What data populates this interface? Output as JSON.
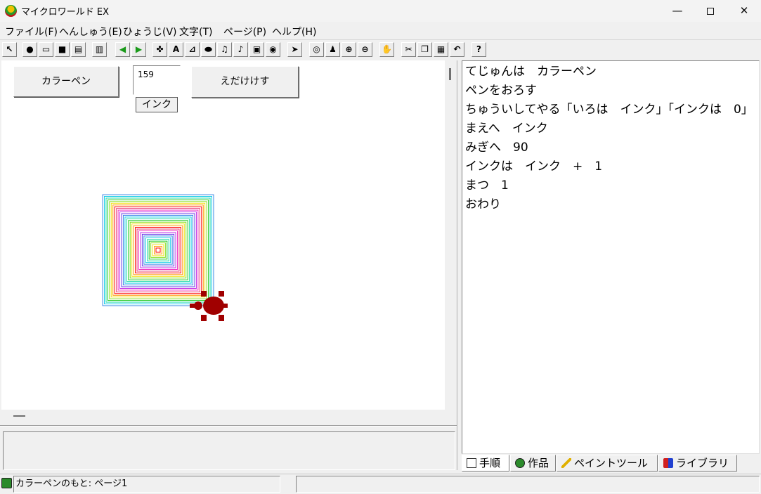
{
  "window": {
    "title": "マイクロワールド EX"
  },
  "menu": [
    "ファイル(F)",
    "へんしゅう(E)",
    "ひょうじ(V)",
    "文字(T)",
    "ページ(P)",
    "ヘルプ(H)"
  ],
  "toolbar": [
    {
      "icon": "pointer-arrow-icon"
    },
    {
      "icon": "globe-icon"
    },
    {
      "icon": "open-folder-icon"
    },
    {
      "icon": "save-icon"
    },
    {
      "icon": "print-icon"
    },
    {
      "icon": "pages-icon"
    },
    {
      "icon": "previous-page-icon"
    },
    {
      "icon": "next-page-icon"
    },
    {
      "icon": "new-turtle-icon"
    },
    {
      "icon": "text-box-icon"
    },
    {
      "icon": "slider-icon"
    },
    {
      "icon": "button-icon"
    },
    {
      "icon": "music-icon"
    },
    {
      "icon": "sound-icon"
    },
    {
      "icon": "video-icon"
    },
    {
      "icon": "shape-center-icon"
    },
    {
      "icon": "select-arrow-icon"
    },
    {
      "icon": "eye-icon"
    },
    {
      "icon": "stamp-icon"
    },
    {
      "icon": "zoom-in-icon"
    },
    {
      "icon": "zoom-out-icon"
    },
    {
      "icon": "stop-hand-icon"
    },
    {
      "icon": "cut-icon"
    },
    {
      "icon": "copy-icon"
    },
    {
      "icon": "paste-icon"
    },
    {
      "icon": "undo-icon"
    },
    {
      "icon": "help-icon",
      "label": "?"
    }
  ],
  "stage": {
    "colorpen_button": "カラーペン",
    "ink_value": "159",
    "ink_label": "インク",
    "erase_button": "えだけけす",
    "pen_colors": [
      "#ff0000",
      "#ff9900",
      "#f4e21c",
      "#88e020",
      "#22c922",
      "#1fd9a8",
      "#1bcfe8",
      "#3f8be8",
      "#6b3ce8",
      "#c331e6",
      "#f23cc4",
      "#e8457a"
    ],
    "turtle_color": "#a00000"
  },
  "editor": {
    "lines": [
      "てじゅんは　カラーペン",
      "ペンをおろす",
      "ちゅういしてやる「いろは　インク」「インクは　0」",
      "まえへ　インク",
      "みぎへ　90",
      "インクは　インク　+　1",
      "まつ　1",
      "おわり"
    ]
  },
  "tabs": [
    {
      "label": "手順",
      "icon": "book-icon",
      "active": true
    },
    {
      "label": "作品",
      "icon": "globe-icon",
      "active": false
    },
    {
      "label": "ペイントツール",
      "icon": "paintbrush-icon",
      "active": false
    },
    {
      "label": "ライブラリ",
      "icon": "shapes-icon",
      "active": false
    }
  ],
  "status": {
    "text": "カラーペンのもと: ページ1"
  }
}
